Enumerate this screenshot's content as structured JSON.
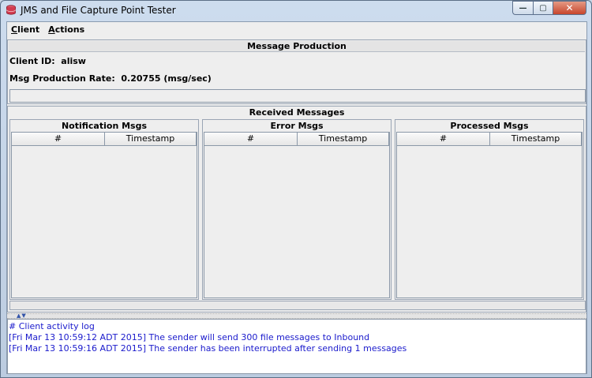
{
  "window": {
    "title": "JMS and File Capture Point Tester"
  },
  "menu": {
    "client": "Client",
    "client_mnemonic": "C",
    "client_rest": "lient",
    "actions": "Actions",
    "actions_mnemonic": "A",
    "actions_rest": "ctions"
  },
  "production": {
    "header": "Message Production",
    "client_id_label": "Client ID:",
    "client_id": "alisw",
    "rate_label": "Msg Production Rate:",
    "rate": "0.20755 (msg/sec)"
  },
  "received": {
    "header": "Received Messages",
    "panels": [
      {
        "title": "Notification Msgs",
        "columns": [
          "#",
          "Timestamp"
        ]
      },
      {
        "title": "Error Msgs",
        "columns": [
          "#",
          "Timestamp"
        ]
      },
      {
        "title": "Processed Msgs",
        "columns": [
          "#",
          "Timestamp"
        ]
      }
    ]
  },
  "log": {
    "lines": [
      "# Client activity log",
      "[Fri Mar 13 10:59:12 ADT 2015]  The sender will send 300 file messages to Inbound",
      "[Fri Mar 13 10:59:16 ADT 2015]  The sender has been interrupted after sending 1 messages"
    ]
  },
  "colors": {
    "log_text": "#1a1acc",
    "close_button": "#c7452c"
  }
}
